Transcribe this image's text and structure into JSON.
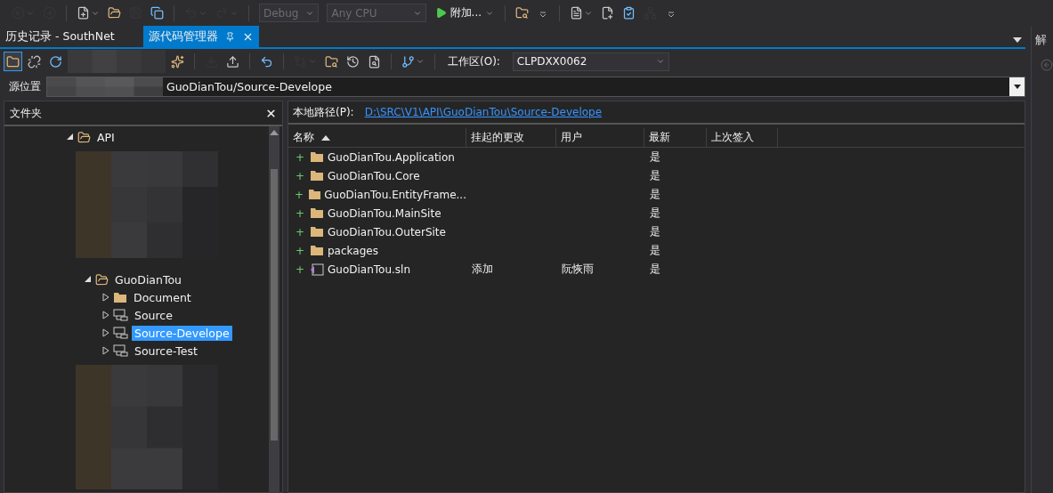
{
  "main_toolbar": [
    {
      "kind": "back",
      "disabled": true,
      "has_dropdown": true
    },
    {
      "kind": "forward",
      "disabled": true
    },
    {
      "kind": "separator"
    },
    {
      "kind": "new_project",
      "disabled": false,
      "has_dropdown": true
    },
    {
      "kind": "open",
      "disabled": false
    },
    {
      "kind": "save",
      "disabled": true
    },
    {
      "kind": "save_all",
      "disabled": false
    },
    {
      "kind": "separator"
    },
    {
      "kind": "undo",
      "disabled": true,
      "has_dropdown": true
    },
    {
      "kind": "redo",
      "disabled": true,
      "has_dropdown": true
    },
    {
      "kind": "separator"
    },
    {
      "kind": "combo",
      "value": "Debug",
      "disabled": true
    },
    {
      "kind": "combo",
      "value": "Any CPU",
      "disabled": true
    },
    {
      "kind": "start",
      "label": "附加...",
      "disabled": false,
      "has_dropdown": true
    },
    {
      "kind": "separator"
    },
    {
      "kind": "find",
      "disabled": false
    },
    {
      "kind": "overflow"
    },
    {
      "kind": "separator"
    },
    {
      "kind": "alert_file",
      "disabled": false,
      "has_dropdown": true
    },
    {
      "kind": "new_item",
      "disabled": false
    },
    {
      "kind": "checklist",
      "disabled": false
    },
    {
      "kind": "network",
      "disabled": true
    },
    {
      "kind": "overflow"
    }
  ],
  "tabs": [
    {
      "label": "历史记录 - SouthNet",
      "selected": false
    },
    {
      "label": "源代码管理器",
      "selected": true
    }
  ],
  "side_panel": {
    "title": "解"
  },
  "explorer_toolbar": [
    {
      "kind": "folders",
      "selected": true,
      "disabled": false
    },
    {
      "kind": "disconnect",
      "selected": false,
      "disabled": false
    },
    {
      "kind": "refresh",
      "selected": false,
      "disabled": false
    },
    {
      "kind": "redacted"
    },
    {
      "kind": "add_item",
      "selected": false,
      "disabled": false
    },
    {
      "kind": "separator"
    },
    {
      "kind": "get_latest",
      "selected": false,
      "disabled": true
    },
    {
      "kind": "check_in",
      "selected": false,
      "disabled": false
    },
    {
      "kind": "separator"
    },
    {
      "kind": "undo",
      "selected": false,
      "disabled": false
    },
    {
      "kind": "separator"
    },
    {
      "kind": "compare",
      "selected": false,
      "disabled": true,
      "has_dropdown": true
    },
    {
      "kind": "find",
      "selected": false,
      "disabled": false
    },
    {
      "kind": "history",
      "selected": false,
      "disabled": false
    },
    {
      "kind": "annotate",
      "selected": false,
      "disabled": false
    },
    {
      "kind": "separator"
    },
    {
      "kind": "branch",
      "selected": false,
      "disabled": false,
      "has_dropdown": true
    },
    {
      "kind": "separator"
    }
  ],
  "workspace": {
    "label": "工作区(O):",
    "value": "CLPDXX0062"
  },
  "source_location": {
    "label": "源位置",
    "value": "GuoDianTou/Source-Develope"
  },
  "folders_panel": {
    "title": "文件夹",
    "tree": [
      {
        "label": "API",
        "kind": "folder",
        "expanded": true,
        "selected": false,
        "children": [
          {
            "label": "GuoDianTou",
            "kind": "folder",
            "expanded": true,
            "selected": false,
            "children": [
              {
                "label": "Document",
                "kind": "plain_folder",
                "expanded": false,
                "selected": false
              },
              {
                "label": "Source",
                "kind": "branch",
                "expanded": false,
                "selected": false
              },
              {
                "label": "Source-Develope",
                "kind": "branch",
                "expanded": false,
                "selected": true
              },
              {
                "label": "Source-Test",
                "kind": "branch",
                "expanded": false,
                "selected": false
              }
            ]
          }
        ]
      }
    ]
  },
  "details": {
    "local_path_label": "本地路径(P):",
    "local_path": "D:\\SRC\\V1\\API\\GuoDianTou\\Source-Develope",
    "columns": [
      {
        "label": "名称",
        "sorted": true
      },
      {
        "label": "挂起的更改",
        "sorted": false
      },
      {
        "label": "用户",
        "sorted": false
      },
      {
        "label": "最新",
        "sorted": false
      },
      {
        "label": "上次签入",
        "sorted": false
      }
    ],
    "rows": [
      {
        "marker": "+",
        "kind": "folder",
        "name": "GuoDianTou.Application",
        "latest": "是"
      },
      {
        "marker": "+",
        "kind": "folder",
        "name": "GuoDianTou.Core",
        "latest": "是"
      },
      {
        "marker": "+",
        "kind": "folder",
        "name": "GuoDianTou.EntityFrame...",
        "latest": "是"
      },
      {
        "marker": "+",
        "kind": "folder",
        "name": "GuoDianTou.MainSite",
        "latest": "是"
      },
      {
        "marker": "+",
        "kind": "folder",
        "name": "GuoDianTou.OuterSite",
        "latest": "是"
      },
      {
        "marker": "+",
        "kind": "folder",
        "name": "packages",
        "latest": "是"
      },
      {
        "marker": "+",
        "kind": "solution",
        "name": "GuoDianTou.sln",
        "pending_change": "添加",
        "user": "阮恢雨",
        "latest": "是"
      }
    ]
  }
}
